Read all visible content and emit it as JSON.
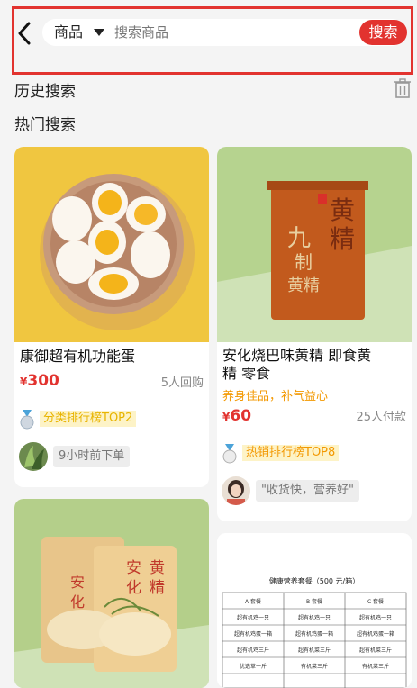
{
  "search": {
    "category": "商品",
    "placeholder": "搜索商品",
    "button": "搜索"
  },
  "sections": {
    "history": "历史搜索",
    "hot": "热门搜索"
  },
  "products": [
    {
      "name": "康御超有机功能蛋",
      "currency": "¥",
      "price": "300",
      "sold": "5人回购",
      "rank": "分类排行榜TOP2",
      "rank_color": "#e8b400",
      "review": "9小时前下单"
    },
    {
      "name_line1": "安化烧巴味黄精 即食黄",
      "name_line2": "精 零食",
      "slogan": "养身佳品，补气益心",
      "currency": "¥",
      "price": "60",
      "sold": "25人付款",
      "rank": "热销排行榜TOP8",
      "rank_color": "#f39800",
      "review": "\"收货快，营养好\""
    },
    {
      "package_brand": "安化黄精",
      "package_chars": [
        "安",
        "化",
        "黄",
        "精"
      ]
    },
    {
      "menu_title": "健康营养套餐（500 元/箱）",
      "menu_headers": [
        "A 套餐",
        "B 套餐",
        "C 套餐"
      ],
      "menu_rows": [
        [
          "超有机鸡一只",
          "超有机鸡一只",
          "超有机鸡一只"
        ],
        [
          "超有机鸡蛋一箱",
          "超有机鸡蛋一箱",
          "超有机鸡蛋一箱"
        ],
        [
          "超有机鸡三斤",
          "超有机菜三斤",
          "超有机菜三斤"
        ],
        [
          "优选草一斤",
          "有机菜三斤",
          "有机菜三斤"
        ]
      ]
    }
  ],
  "colors": {
    "accent": "#e2332f",
    "slogan": "#f39800"
  }
}
